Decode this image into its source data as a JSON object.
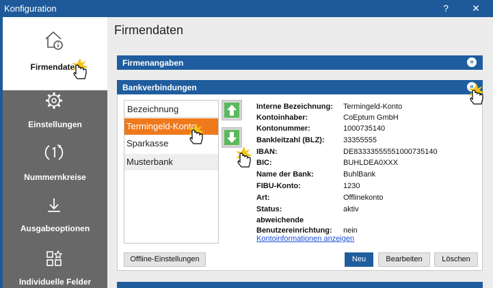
{
  "window": {
    "title": "Konfiguration",
    "help_glyph": "?",
    "close_glyph": "✕"
  },
  "sidebar": {
    "items": [
      {
        "label": "Firmendaten",
        "icon": "home-info-icon",
        "active": true
      },
      {
        "label": "Einstellungen",
        "icon": "gear-icon",
        "active": false
      },
      {
        "label": "Nummernkreise",
        "icon": "cycle-1-icon",
        "active": false
      },
      {
        "label": "Ausgabeoptionen",
        "icon": "download-icon",
        "active": false
      },
      {
        "label": "Individuelle Felder",
        "icon": "grid-star-icon",
        "active": false
      }
    ]
  },
  "page": {
    "title": "Firmendaten"
  },
  "panels": {
    "firmenangaben": {
      "title": "Firmenangaben",
      "chevron": "»"
    },
    "bankverbindungen": {
      "title": "Bankverbindungen",
      "chevron": "«"
    }
  },
  "bank_list": {
    "header": "Bezeichnung",
    "rows": [
      "Termingeld-Konto",
      "Sparkasse",
      "Musterbank"
    ],
    "selected_index": 0
  },
  "details": [
    {
      "key": "Interne Bezeichnung:",
      "value": "Termingeld-Konto"
    },
    {
      "key": "Kontoinhaber:",
      "value": "CoEptum GmbH"
    },
    {
      "key": "Kontonummer:",
      "value": "1000735140"
    },
    {
      "key": "Bankleitzahl (BLZ):",
      "value": "33355555"
    },
    {
      "key": "IBAN:",
      "value": "DE83333555551000735140"
    },
    {
      "key": "BIC:",
      "value": "BUHLDEA0XXX"
    },
    {
      "key": "Name der Bank:",
      "value": "BuhlBank"
    },
    {
      "key": "FIBU-Konto:",
      "value": "1230"
    },
    {
      "key": "Art:",
      "value": "Offlinekonto"
    },
    {
      "key": "Status:",
      "value": "aktiv"
    },
    {
      "key": "abweichende",
      "key2": "Benutzereinrichtung:",
      "value": "nein"
    }
  ],
  "link": {
    "label": "Kontoinformationen anzeigen"
  },
  "buttons": {
    "offline": "Offline-Einstellungen",
    "neu": "Neu",
    "bearbeiten": "Bearbeiten",
    "loeschen": "Löschen"
  },
  "colors": {
    "accent": "#1f5d9e",
    "selection": "#ee7a1c",
    "arrow_green": "#5cb85c"
  }
}
